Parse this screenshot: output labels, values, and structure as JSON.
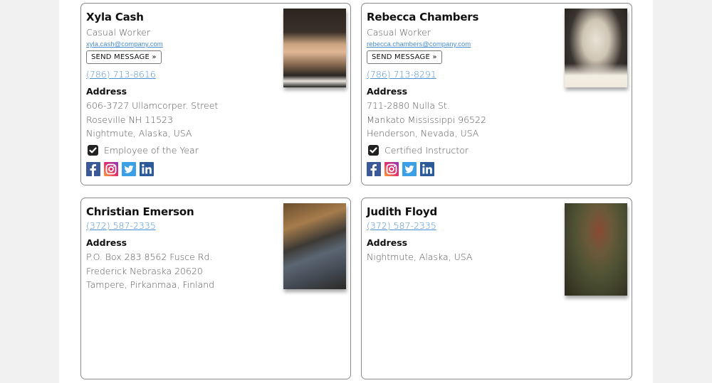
{
  "contacts": [
    {
      "name": "Xyla Cash",
      "role": "Casual Worker",
      "email": "xyla.cash@company.com",
      "send_label": "SEND MESSAGE »",
      "phone": "(786) 713-8616",
      "address_heading": "Address",
      "address": [
        "606-3727 Ullamcorper. Street",
        "Roseville NH 11523",
        "Nightmute, Alaska, USA"
      ],
      "badge": "Employee of the Year",
      "photo": "portrait-woman-fur-hat",
      "socials": [
        "facebook-icon",
        "instagram-icon",
        "twitter-icon",
        "linkedin-icon"
      ]
    },
    {
      "name": "Rebecca Chambers",
      "role": "Casual Worker",
      "email": "rebecca.chambers@company.com",
      "send_label": "SEND MESSAGE »",
      "phone": "(786) 713-8291",
      "address_heading": "Address",
      "address": [
        "711-2880 Nulla St.",
        "Mankato Mississippi 96522",
        "Henderson, Nevada, USA"
      ],
      "badge": "Certified Instructor",
      "photo": "portrait-woman-bw",
      "socials": [
        "facebook-icon",
        "instagram-icon",
        "twitter-icon",
        "linkedin-icon"
      ]
    },
    {
      "name": "Christian Emerson",
      "phone": "(372) 587-2335",
      "address_heading": "Address",
      "address": [
        "P.O. Box 283 8562 Fusce Rd.",
        "Frederick Nebraska 20620",
        "Tampere, Pirkanmaa, Finland"
      ],
      "photo": "portrait-man-suit"
    },
    {
      "name": "Judith Floyd",
      "phone": "(372) 587-2335",
      "address_heading": "Address",
      "address": [
        "Nightmute, Alaska, USA"
      ],
      "photo": "portrait-woman-plants-camera"
    }
  ],
  "colors": {
    "link": "#4a8fd0",
    "facebook": "#3b5998",
    "twitter": "#3ba0e6",
    "linkedin": "#2c5a98"
  }
}
